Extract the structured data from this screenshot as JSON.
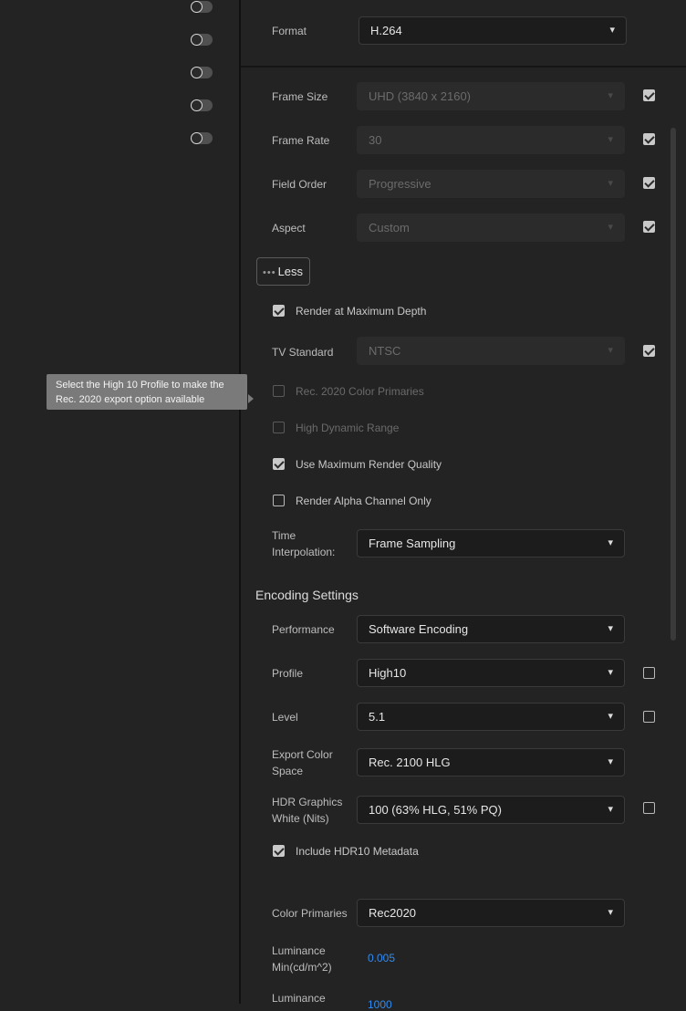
{
  "tooltip": {
    "text": "Select the High 10 Profile to make the Rec. 2020 export option available"
  },
  "format": {
    "label": "Format",
    "value": "H.264"
  },
  "video": {
    "frame_size": {
      "label": "Frame Size",
      "value": "UHD (3840 x 2160)",
      "match_source": true
    },
    "frame_rate": {
      "label": "Frame Rate",
      "value": "30",
      "match_source": true
    },
    "field_order": {
      "label": "Field Order",
      "value": "Progressive",
      "match_source": true
    },
    "aspect": {
      "label": "Aspect",
      "value": "Custom",
      "match_source": true
    },
    "less_button": {
      "dots": "•••",
      "label": "Less"
    },
    "render_max_depth": {
      "label": "Render at Maximum Depth",
      "checked": true
    },
    "tv_standard": {
      "label": "TV Standard",
      "value": "NTSC",
      "match_source": true
    },
    "rec2020": {
      "label": "Rec. 2020 Color Primaries",
      "checked": false,
      "enabled": false
    },
    "hdr": {
      "label": "High Dynamic Range",
      "checked": false,
      "enabled": false
    },
    "max_render_quality": {
      "label": "Use Maximum Render Quality",
      "checked": true
    },
    "alpha_only": {
      "label": "Render Alpha Channel Only",
      "checked": false
    },
    "time_interp": {
      "label": "Time Interpolation:",
      "value": "Frame Sampling"
    }
  },
  "encoding": {
    "title": "Encoding Settings",
    "performance": {
      "label": "Performance",
      "value": "Software Encoding"
    },
    "profile": {
      "label": "Profile",
      "value": "High10",
      "match_source": false
    },
    "level": {
      "label": "Level",
      "value": "5.1",
      "match_source": false
    },
    "color_space": {
      "label": "Export Color Space",
      "value": "Rec. 2100 HLG"
    },
    "hdr_white": {
      "label": "HDR Graphics White (Nits)",
      "value": "100 (63% HLG, 51% PQ)",
      "match_source": false
    },
    "hdr10_meta": {
      "label": "Include HDR10 Metadata",
      "checked": true
    },
    "color_primaries": {
      "label": "Color Primaries",
      "value": "Rec2020"
    },
    "lum_min": {
      "label": "Luminance Min(cd/m^2)",
      "value": "0.005"
    },
    "lum_max": {
      "label": "Luminance",
      "value": "1000"
    }
  },
  "colors": {
    "accent": "#2f8cf3",
    "tooltip_bg": "#7a7a7a",
    "panel_bg": "#232323"
  }
}
